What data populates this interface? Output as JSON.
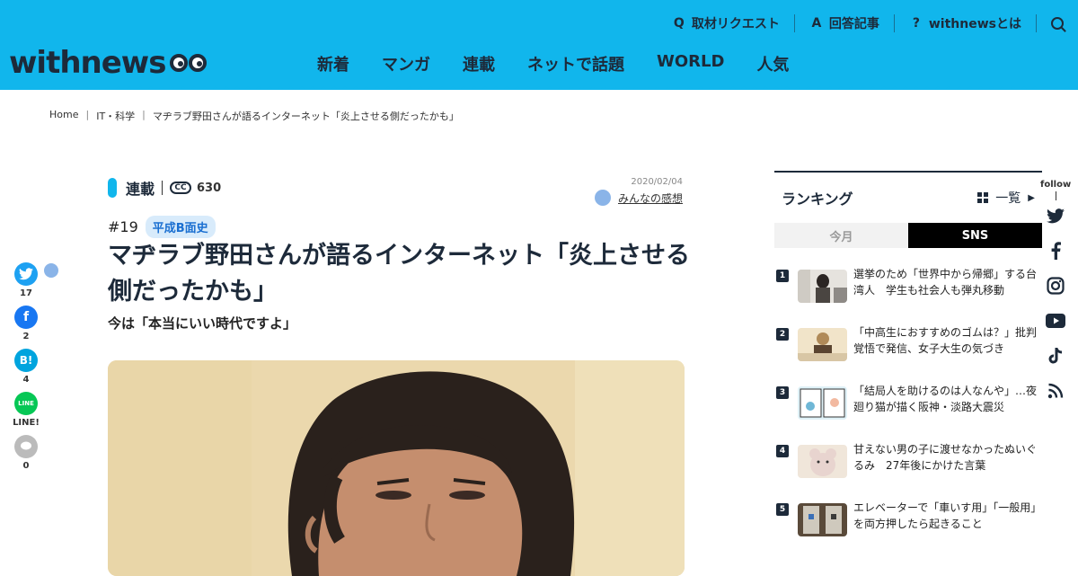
{
  "header": {
    "logo_text": "withnews",
    "top_links": [
      {
        "label": "取材リクエスト",
        "icon": "q-icon"
      },
      {
        "label": "回答記事",
        "icon": "a-icon"
      },
      {
        "label": "withnewsとは",
        "icon": "question-icon"
      }
    ],
    "nav": [
      "新着",
      "マンガ",
      "連載",
      "ネットで話題",
      "WORLD",
      "人気"
    ]
  },
  "breadcrumb": [
    "Home",
    "IT・科学",
    "マヂラブ野田さんが語るインターネット「炎上させる側だったかも」"
  ],
  "share": {
    "twitter_count": "17",
    "facebook_count": "2",
    "hatena_count": "4",
    "line_label": "LINE!",
    "comment_count": "0"
  },
  "article": {
    "series_label": "連載",
    "view_count": "630",
    "date": "2020/02/04",
    "kanso_label": "みんなの感想",
    "episode": "#19",
    "tag": "平成B面史",
    "title": "マヂラブ野田さんが語るインターネット「炎上させる側だったかも」",
    "subtitle": "今は「本当にいい時代ですよ」"
  },
  "ranking": {
    "title": "ランキング",
    "all_label": "一覧",
    "tabs": [
      "今月",
      "SNS"
    ],
    "active_tab": "SNS",
    "items": [
      {
        "rank": "1",
        "text": "選挙のため「世界中から帰郷」する台湾人　学生も社会人も弾丸移動"
      },
      {
        "rank": "2",
        "text": "「中高生におすすめのゴムは？」批判覚悟で発信、女子大生の気づき"
      },
      {
        "rank": "3",
        "text": "「結局人を助けるのは人なんや」…夜廻り猫が描く阪神・淡路大震災"
      },
      {
        "rank": "4",
        "text": "甘えない男の子に渡せなかったぬいぐるみ　27年後にかけた言葉"
      },
      {
        "rank": "5",
        "text": "エレベーターで「車いす用」「一般用」を両方押したら起きること"
      }
    ]
  },
  "follow": {
    "label": "follow"
  },
  "colors": {
    "brand": "#11b6ec",
    "navy": "#1d2a3a",
    "twitter": "#1da1f2",
    "facebook": "#1877f2",
    "line": "#06c755"
  }
}
